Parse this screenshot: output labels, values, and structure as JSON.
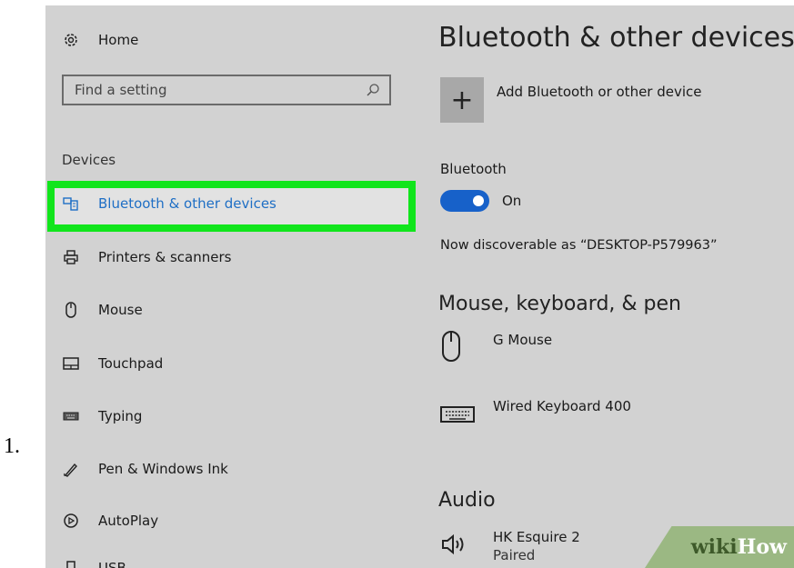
{
  "step_number": "1.",
  "sidebar": {
    "home_label": "Home",
    "search_placeholder": "Find a setting",
    "group_label": "Devices",
    "items": [
      {
        "label": "Bluetooth & other devices",
        "icon": "bluetooth-devices-icon",
        "selected": true
      },
      {
        "label": "Printers & scanners",
        "icon": "printer-icon"
      },
      {
        "label": "Mouse",
        "icon": "mouse-icon"
      },
      {
        "label": "Touchpad",
        "icon": "touchpad-icon"
      },
      {
        "label": "Typing",
        "icon": "keyboard-icon"
      },
      {
        "label": "Pen & Windows Ink",
        "icon": "pen-icon"
      },
      {
        "label": "AutoPlay",
        "icon": "autoplay-icon"
      },
      {
        "label": "USB",
        "icon": "usb-icon"
      }
    ]
  },
  "main": {
    "title": "Bluetooth & other devices",
    "add_device_label": "Add Bluetooth or other device",
    "bluetooth_label": "Bluetooth",
    "bluetooth_state": "On",
    "discoverable_text": "Now discoverable as “DESKTOP-P579963”",
    "sections": {
      "mkp_title": "Mouse, keyboard, & pen",
      "audio_title": "Audio"
    },
    "devices": {
      "mouse": "G Mouse",
      "keyboard": "Wired Keyboard 400",
      "audio_name": "HK Esquire 2",
      "audio_status": "Paired"
    }
  },
  "watermark": {
    "wiki": "wiki",
    "how": "How"
  },
  "colors": {
    "highlight": "#11e51c",
    "accent": "#1761c9",
    "background": "#d2d2d2"
  }
}
